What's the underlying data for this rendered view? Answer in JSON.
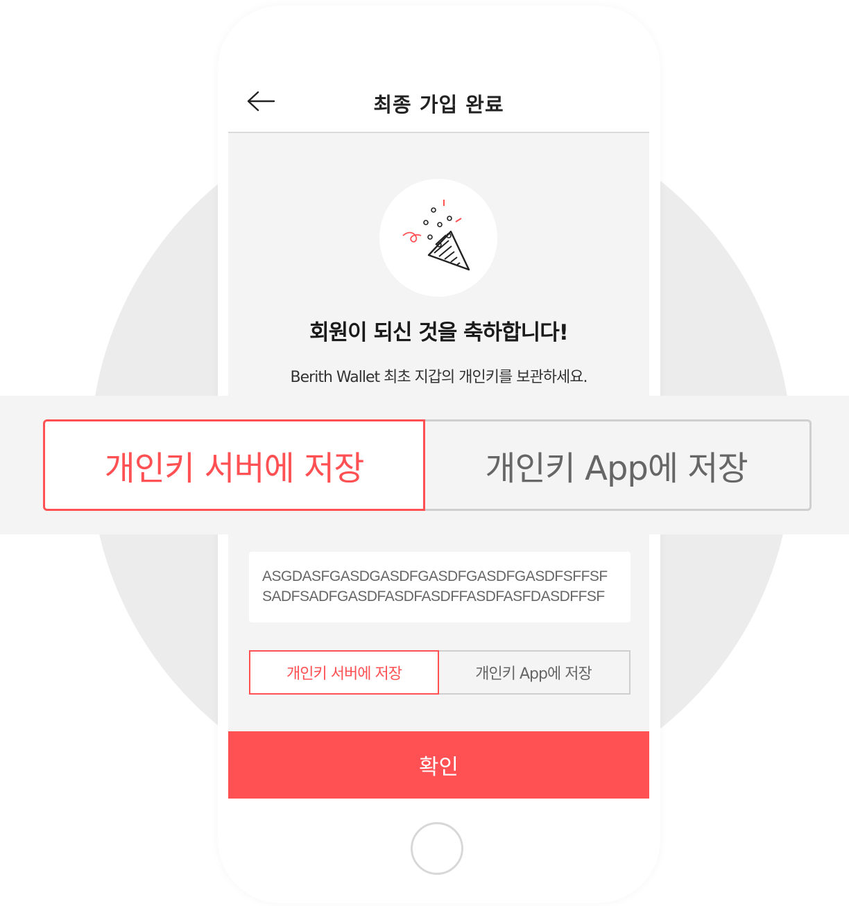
{
  "header": {
    "back_icon": "arrow-left-icon",
    "title": "최종 가입 완료"
  },
  "celebration": {
    "icon": "party-popper-icon",
    "heading": "회원이 되신 것을 축하합니다!",
    "instruction": "Berith Wallet 최초 지갑의 개인키를 보관하세요."
  },
  "private_key": {
    "line1": "ASGDASFGASDGASDFGASDFGASDFGASDFSFFSF",
    "line2": "SADFSADFGASDFASDFASDFFASDFASFDASDFFSF"
  },
  "storage_options": {
    "server_label": "개인키 서버에 저장",
    "app_label": "개인키 App에 저장",
    "selected": "server"
  },
  "confirm_label": "확인",
  "colors": {
    "accent": "#ff5053",
    "screen_bg": "#f4f4f4",
    "backdrop_circle": "#ececec"
  }
}
